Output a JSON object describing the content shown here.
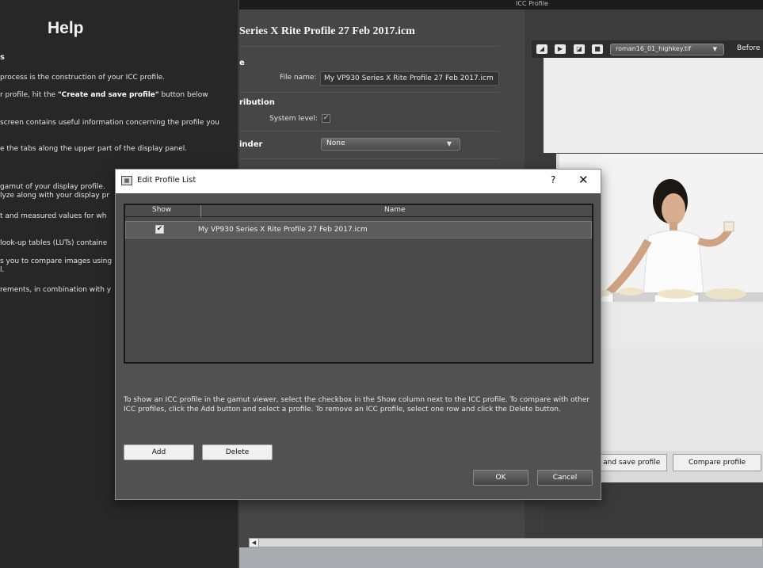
{
  "window": {
    "title": "ICC Profile"
  },
  "help": {
    "title": "Help",
    "section": "s",
    "lines": [
      "process is the construction of your ICC profile.",
      "r profile, hit the ",
      "screen contains useful information concerning the profile you",
      "e the tabs along the upper part of the display panel.",
      "gamut of your display profile.",
      "lyze along with your display pr",
      "t and measured values for wh",
      "look-up tables (LUTs) containe",
      "s you to compare images using",
      "l.",
      "rements, in combination with y"
    ],
    "bold_phrase": "\"Create and save profile\"",
    "line2_tail": " button below"
  },
  "main": {
    "profile_title": "Series X Rite Profile 27 Feb 2017.icm",
    "section_name": "e",
    "file_name_label": "File name:",
    "file_name_value": "My VP930 Series X Rite Profile 27 Feb 2017.icm",
    "section_distribution": "ribution",
    "system_level_label": "System level:",
    "system_level_check": "✔",
    "binder_label": "inder",
    "binder_value": "None",
    "binder_arrow": "▼"
  },
  "viewer": {
    "tools": [
      "◢",
      "▶",
      "◪",
      "■"
    ],
    "image_select": "roman16_01_highkey.tif",
    "image_select_arrow": "▼",
    "before_label": "Before",
    "create_save_button": "e and save profile",
    "compare_button": "Compare profile"
  },
  "scroll": {
    "left_arrow": "◀"
  },
  "dialog": {
    "icon": "▦",
    "title": "Edit Profile List",
    "help": "?",
    "close": "✕",
    "col_show": "Show",
    "col_name": "Name",
    "rows": [
      {
        "check": "✔",
        "name": "My VP930 Series X Rite Profile 27 Feb 2017.icm"
      }
    ],
    "info_line1": "To show an ICC profile in the gamut viewer, select the checkbox in the Show column next to the ICC profile. To compare with other",
    "info_line2": "ICC profiles, click the Add button and select a profile. To remove an ICC profile, select one row and click the Delete button.",
    "add": "Add",
    "delete": "Delete",
    "ok": "OK",
    "cancel": "Cancel"
  }
}
